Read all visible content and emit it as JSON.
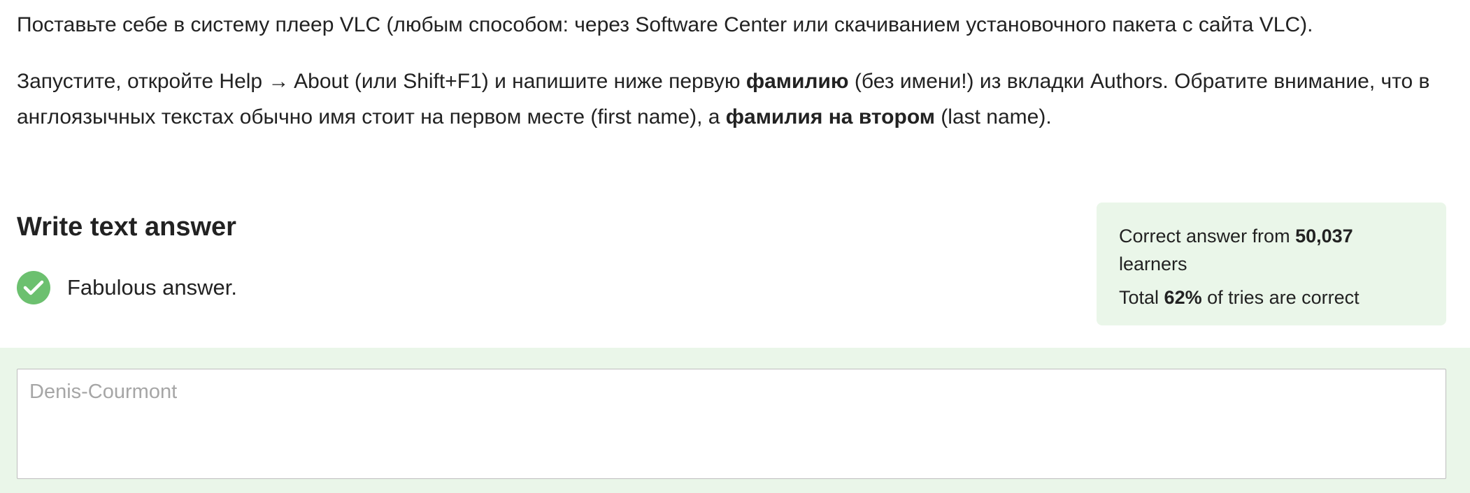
{
  "lesson": {
    "paragraph1": "Поставьте себе в систему плеер VLC (любым способом: через Software Center или скачиванием установочного пакета с сайта VLC).",
    "paragraph2": {
      "part1": "Запустите, откройте Help → About (или Shift+F1) и напишите ниже первую ",
      "bold1": "фамилию",
      "part2": " (без имени!) из вкладки Authors. Обратите внимание, что в англоязычных текстах обычно имя стоит на первом месте (first name), а ",
      "bold2": "фамилия на втором",
      "part3": " (last name)."
    }
  },
  "answer_section": {
    "heading": "Write text answer",
    "feedback": "Fabulous answer.",
    "feedback_icon": "check-circle-icon",
    "success_color": "#6cc06f"
  },
  "stats": {
    "correct_prefix": "Correct answer from ",
    "learners_count": "50,037",
    "learners_suffix": " learners",
    "total_prefix": "Total ",
    "percent": "62%",
    "total_suffix": " of tries are correct",
    "background_color": "#eaf6e9"
  },
  "answer_input": {
    "value": "",
    "placeholder": "Denis-Courmont"
  }
}
